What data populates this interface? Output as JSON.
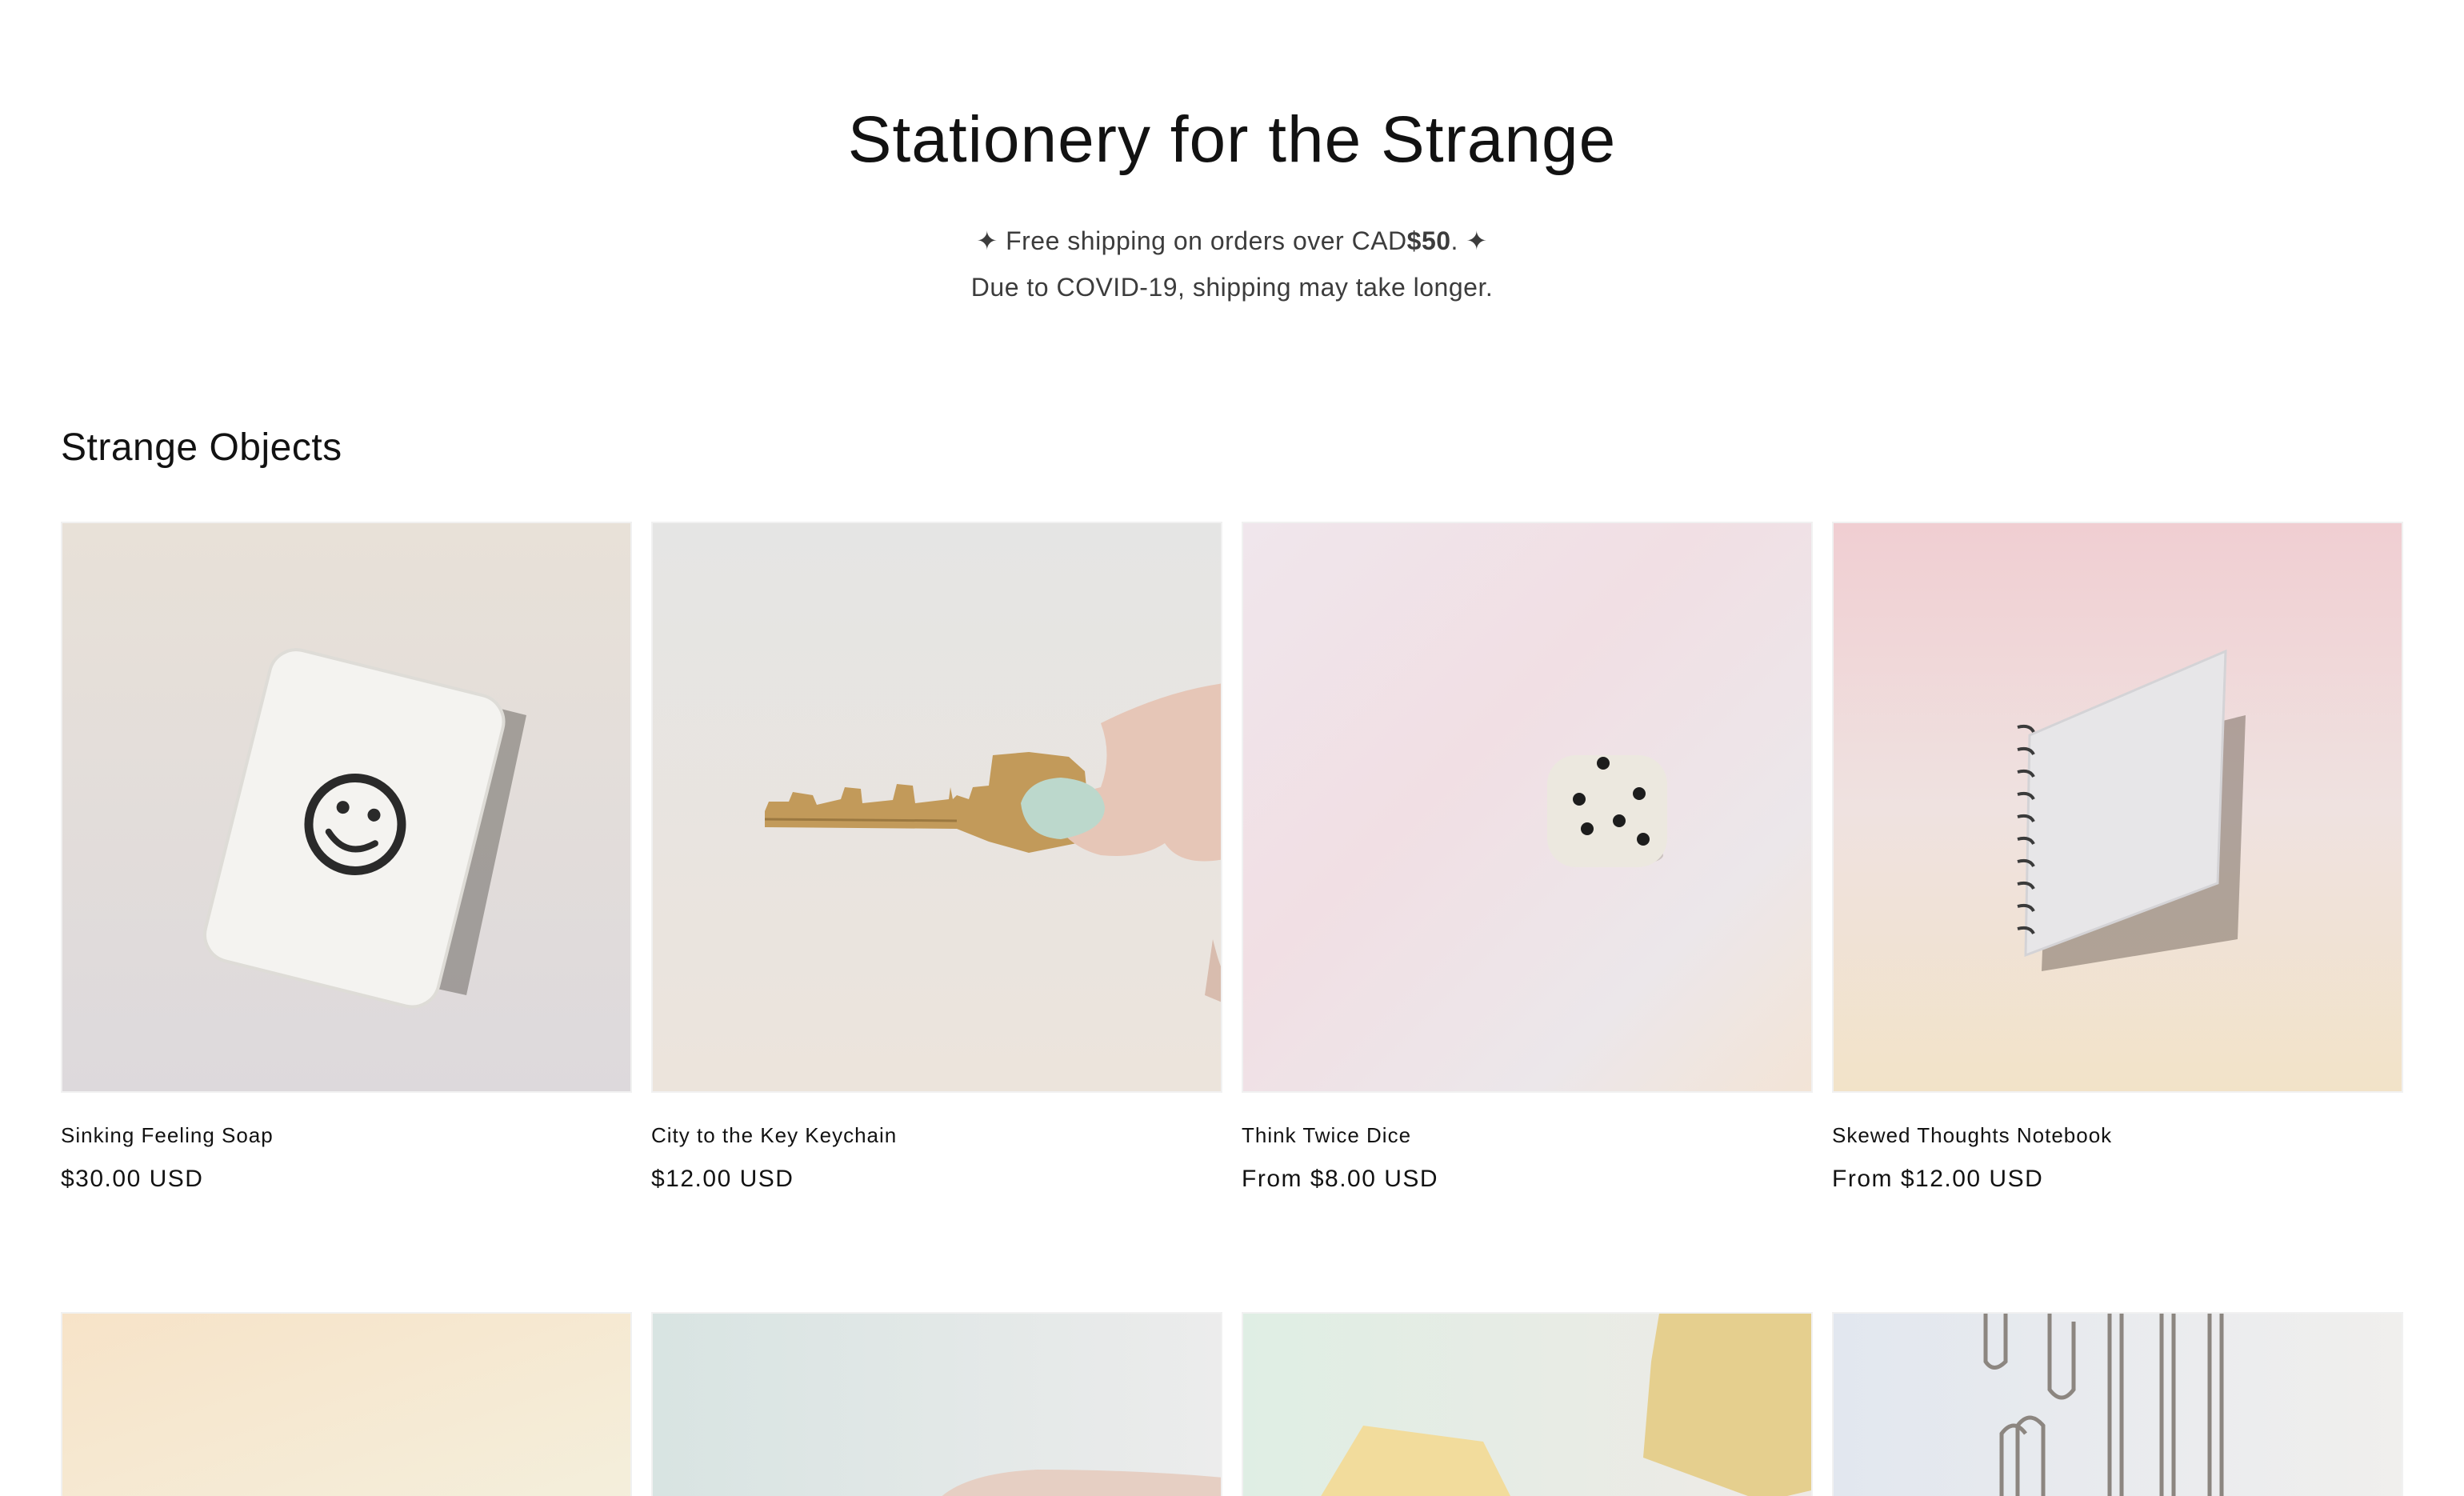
{
  "hero": {
    "title": "Stationery for the Strange",
    "shipping_prefix": "✦ Free shipping on orders over CAD",
    "shipping_amount": "$50",
    "shipping_suffix": ". ✦",
    "covid_note": "Due to COVID-19, shipping may take longer."
  },
  "collection": {
    "title": "Strange Objects",
    "products": [
      {
        "name": "Sinking Feeling Soap",
        "price": "$30.00 USD",
        "icon": "soap-smiley-image"
      },
      {
        "name": "City to the Key Keychain",
        "price": "$12.00 USD",
        "icon": "key-keychain-image"
      },
      {
        "name": "Think Twice Dice",
        "price": "From $8.00 USD",
        "icon": "dice-image"
      },
      {
        "name": "Skewed Thoughts Notebook",
        "price": "From $12.00 USD",
        "icon": "notebook-image"
      }
    ],
    "row2_icons": [
      "pastel-product-image",
      "hand-product-image",
      "sticky-notes-image",
      "paperclips-image"
    ]
  },
  "colors": {
    "text": "#121212",
    "muted_text": "#3c3c3c",
    "background": "#ffffff"
  }
}
